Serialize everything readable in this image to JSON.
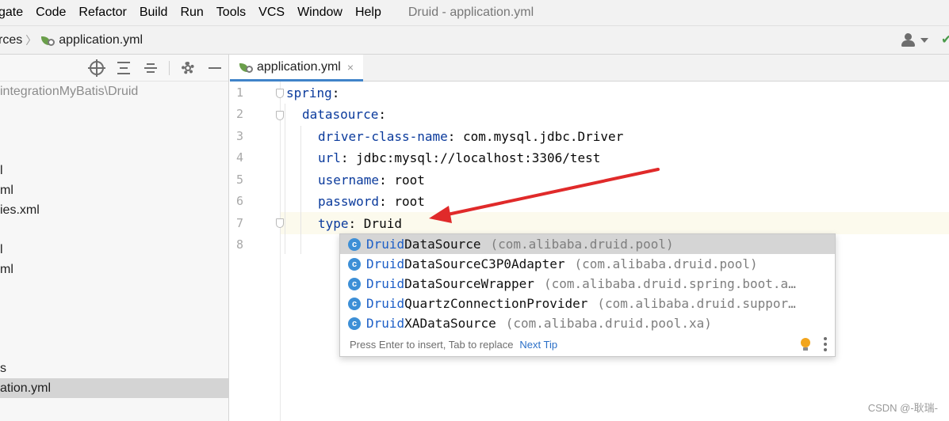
{
  "menu": {
    "items": [
      {
        "label": "gate"
      },
      {
        "label": "Code"
      },
      {
        "label": "Refactor"
      },
      {
        "label": "Build"
      },
      {
        "label": "Run"
      },
      {
        "label": "Tools"
      },
      {
        "label": "VCS"
      },
      {
        "label": "Window"
      },
      {
        "label": "Help"
      }
    ],
    "window_title": "Druid - application.yml"
  },
  "breadcrumb": {
    "parent": "rces",
    "separator": "〉",
    "file": "application.yml"
  },
  "project_tree": {
    "rows": [
      {
        "text": "integrationMyBatis\\Druid",
        "style": "path"
      },
      {
        "text": "l"
      },
      {
        "text": "ml"
      },
      {
        "text": "ies.xml"
      },
      {
        "text": "l"
      },
      {
        "text": "ml"
      },
      {
        "text": "s"
      },
      {
        "text": "ation.yml",
        "selected": true
      }
    ]
  },
  "editor": {
    "tab": {
      "label": "application.yml",
      "close": "×"
    },
    "line_numbers": [
      "1",
      "2",
      "3",
      "4",
      "5",
      "6",
      "7",
      "8"
    ],
    "lines": [
      {
        "key": "spring",
        "sep": ":",
        "value": ""
      },
      {
        "key": "datasource",
        "sep": ":",
        "value": ""
      },
      {
        "key": "driver-class-name",
        "sep": ": ",
        "value": "com.mysql.jdbc.Driver"
      },
      {
        "key": "url",
        "sep": ": ",
        "value": "jdbc:mysql://localhost:3306/test"
      },
      {
        "key": "username",
        "sep": ": ",
        "value": "root"
      },
      {
        "key": "password",
        "sep": ": ",
        "value": "root"
      },
      {
        "key": "type",
        "sep": ": ",
        "value": "Druid"
      }
    ]
  },
  "completion": {
    "icon_letter": "c",
    "items": [
      {
        "match": "Druid",
        "rest": "DataSource",
        "pkg": "(com.alibaba.druid.pool)",
        "selected": true
      },
      {
        "match": "Druid",
        "rest": "DataSourceC3P0Adapter",
        "pkg": "(com.alibaba.druid.pool)"
      },
      {
        "match": "Druid",
        "rest": "DataSourceWrapper",
        "pkg": "(com.alibaba.druid.spring.boot.a…"
      },
      {
        "match": "Druid",
        "rest": "QuartzConnectionProvider",
        "pkg": "(com.alibaba.druid.suppor…"
      },
      {
        "match": "Druid",
        "rest": "XADataSource",
        "pkg": "(com.alibaba.druid.pool.xa)"
      }
    ],
    "footer_hint": "Press Enter to insert, Tab to replace",
    "footer_tip": "Next Tip"
  },
  "watermark": "CSDN @-耿瑞-",
  "colors": {
    "accent": "#4083c9",
    "yaml_key": "#0a3a9c",
    "match_highlight": "#1d5fc7",
    "arrow": "#e02a2a",
    "class_icon": "#3d8fd6"
  }
}
